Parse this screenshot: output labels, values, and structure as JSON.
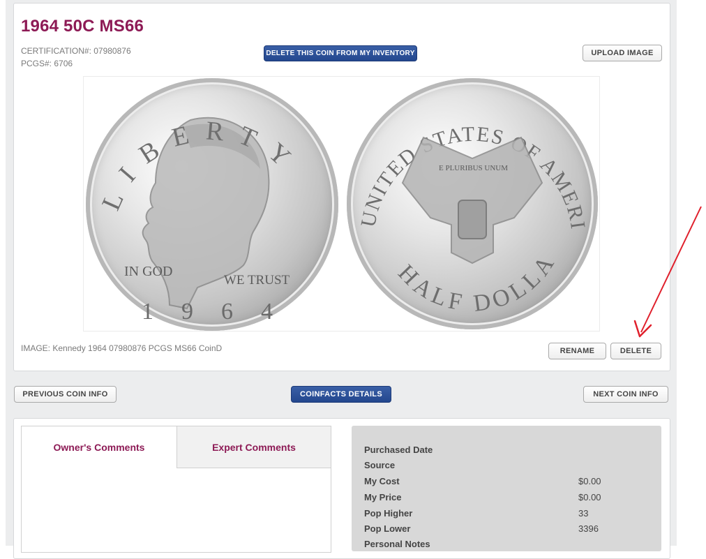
{
  "coin": {
    "title": "1964 50C MS66",
    "certification": "CERTIFICATION#: 07980876",
    "pcgs": "PCGS#: 6706"
  },
  "buttons": {
    "delete_inventory": "DELETE THIS COIN FROM MY INVENTORY",
    "upload_image": "UPLOAD IMAGE",
    "rename": "RENAME",
    "delete": "DELETE",
    "previous": "PREVIOUS COIN INFO",
    "coinfacts": "COINFACTS DETAILS",
    "next": "NEXT COIN INFO"
  },
  "image": {
    "caption": "IMAGE: Kennedy 1964 07980876 PCGS MS66 CoinD",
    "obverse": {
      "top_legend": "LIBERTY",
      "left_motto": "IN GOD",
      "right_motto": "WE TRUST",
      "date": "1964"
    },
    "reverse": {
      "top_legend": "UNITED STATES OF AMERICA",
      "bottom_legend": "HALF DOLLAR",
      "ribbon": "E PLURIBUS UNUM"
    }
  },
  "tabs": {
    "owner": "Owner's Comments",
    "expert": "Expert Comments"
  },
  "info": [
    {
      "label": "Purchased Date",
      "value": ""
    },
    {
      "label": "Source",
      "value": ""
    },
    {
      "label": "My Cost",
      "value": "$0.00"
    },
    {
      "label": "My Price",
      "value": "$0.00"
    },
    {
      "label": "Pop Higher",
      "value": "33"
    },
    {
      "label": "Pop Lower",
      "value": "3396"
    },
    {
      "label": "Personal Notes",
      "value": ""
    }
  ],
  "colors": {
    "title": "#8d1a55",
    "blue_button": "#23478e",
    "annotation_arrow": "#e0202c"
  }
}
